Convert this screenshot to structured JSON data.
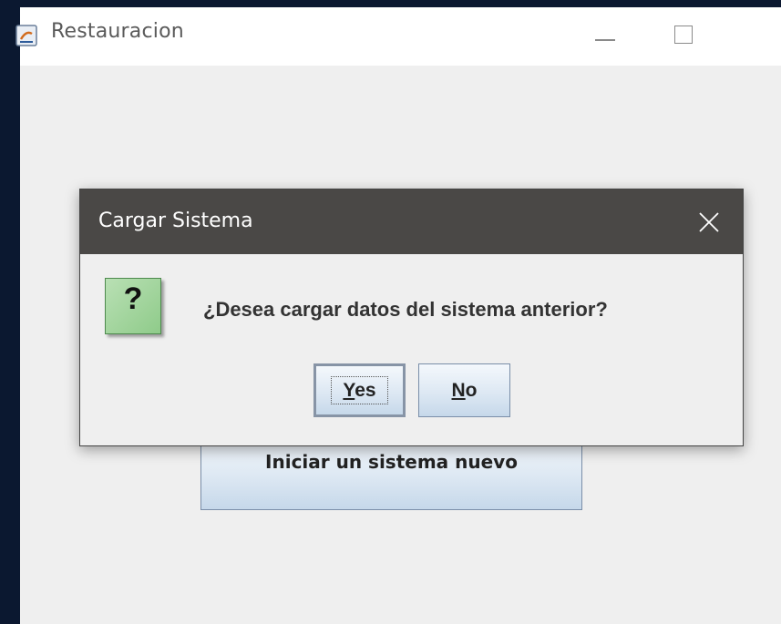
{
  "main_window": {
    "title": "Restauracion",
    "new_system_label": "Iniciar un sistema nuevo"
  },
  "dialog": {
    "title": "Cargar Sistema",
    "message": "¿Desea cargar datos del sistema anterior?",
    "icon": "question-icon",
    "icon_glyph": "?",
    "buttons": {
      "yes_mnemonic": "Y",
      "yes_rest": "es",
      "no_mnemonic": "N",
      "no_rest": "o"
    }
  },
  "colors": {
    "dialog_titlebar": "#4a4846",
    "window_bg": "#efefef",
    "button_gradient_bottom": "#c6d8ea",
    "question_icon_bg": "#8fcb8a",
    "desktop_bg": "#0b1830"
  }
}
